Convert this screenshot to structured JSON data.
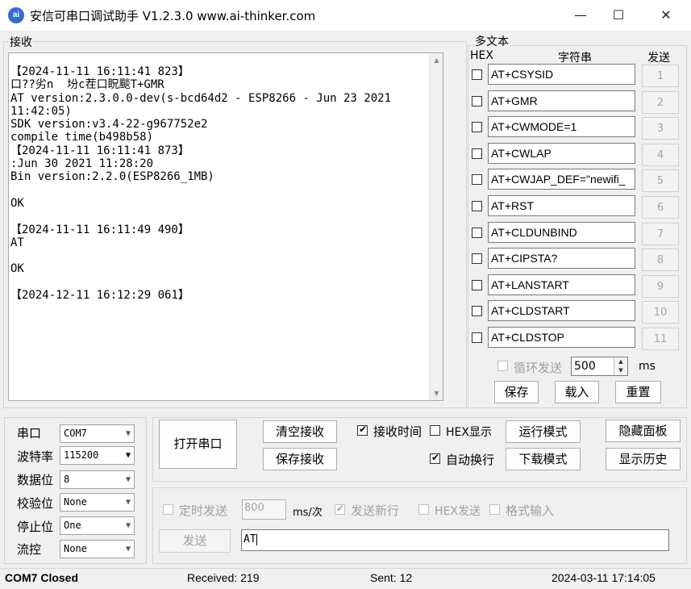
{
  "window": {
    "icon_text": "ai",
    "title": "安信可串口调试助手 V1.2.3.0    www.ai-thinker.com",
    "minimize": "—",
    "maximize": "☐",
    "close": "✕"
  },
  "receive": {
    "label": "接收",
    "lines": [
      "【2024-11-11 16:11:41 823】",
      "口??劣n  坋c茬口眖颷T+GMR",
      "AT version:2.3.0.0-dev(s-bcd64d2 - ESP8266 - Jun 23 2021",
      "11:42:05)",
      "SDK version:v3.4-22-g967752e2",
      "compile time(b498b58)",
      "【2024-11-11 16:11:41 873】",
      ":Jun 30 2021 11:28:20",
      "Bin version:2.2.0(ESP8266_1MB)",
      "",
      "OK",
      "",
      "【2024-11-11 16:11:49 490】",
      "AT",
      "",
      "OK",
      "",
      "【2024-12-11 16:12:29 061】"
    ]
  },
  "multi": {
    "label": "多文本",
    "col_hex": "HEX",
    "col_string": "字符串",
    "col_send": "发送",
    "items": [
      {
        "text": "AT+CSYSID",
        "num": "1"
      },
      {
        "text": "AT+GMR",
        "num": "2"
      },
      {
        "text": "AT+CWMODE=1",
        "num": "3"
      },
      {
        "text": "AT+CWLAP",
        "num": "4"
      },
      {
        "text": "AT+CWJAP_DEF=\"newifi_",
        "num": "5"
      },
      {
        "text": "AT+RST",
        "num": "6"
      },
      {
        "text": "AT+CLDUNBIND",
        "num": "7"
      },
      {
        "text": "AT+CIPSTA?",
        "num": "8"
      },
      {
        "text": "AT+LANSTART",
        "num": "9"
      },
      {
        "text": "AT+CLDSTART",
        "num": "10"
      },
      {
        "text": "AT+CLDSTOP",
        "num": "11"
      }
    ],
    "loop_label": "循环发送",
    "loop_value": "500",
    "loop_unit": "ms",
    "save": "保存",
    "load": "载入",
    "reset": "重置"
  },
  "settings": {
    "port_label": "串口",
    "port_value": "COM7",
    "baud_label": "波特率",
    "baud_value": "115200",
    "data_label": "数据位",
    "data_value": "8",
    "parity_label": "校验位",
    "parity_value": "None",
    "stop_label": "停止位",
    "stop_value": "One",
    "flow_label": "流控",
    "flow_value": "None"
  },
  "controls": {
    "open_port": "打开串口",
    "clear_recv": "清空接收",
    "save_recv": "保存接收",
    "recv_time": "接收时间",
    "hex_display": "HEX显示",
    "auto_wrap": "自动换行",
    "run_mode": "运行模式",
    "download_mode": "下载模式",
    "hide_panel": "隐藏面板",
    "show_history": "显示历史"
  },
  "send": {
    "timed_send": "定时发送",
    "interval": "800",
    "interval_unit": "ms/次",
    "send_newline": "发送新行",
    "hex_send": "HEX发送",
    "format_input": "格式输入",
    "send_button": "发送",
    "input_value": "AT"
  },
  "status": {
    "port": "COM7 Closed",
    "received": "Received: 219",
    "sent": "Sent: 12",
    "datetime": "2024-03-11 17:14:05"
  }
}
